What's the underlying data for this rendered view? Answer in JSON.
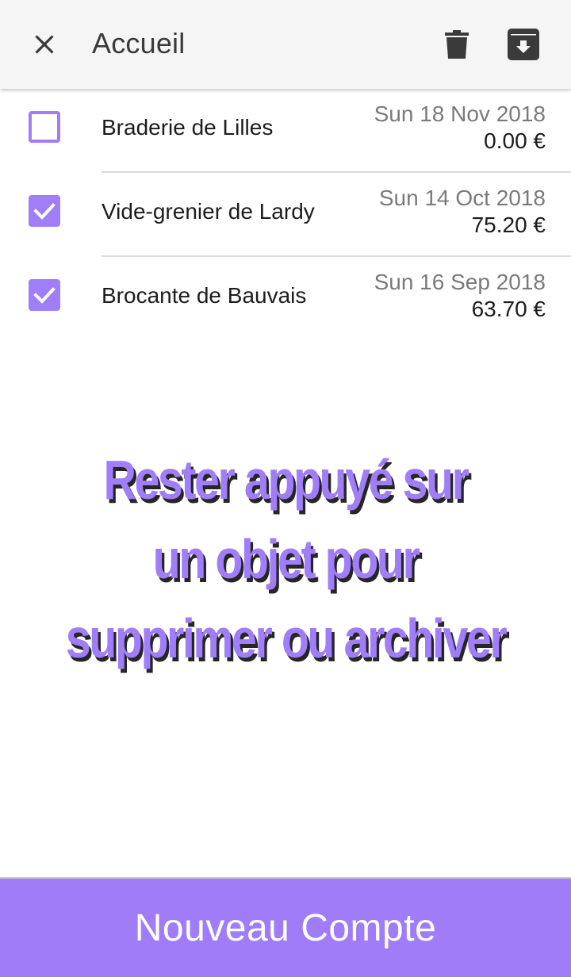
{
  "appbar": {
    "title": "Accueil",
    "icons": {
      "close": "close-icon",
      "delete": "trash-icon",
      "archive": "archive-icon"
    }
  },
  "items": [
    {
      "name": "Braderie de Lilles",
      "date": "Sun 18 Nov 2018",
      "amount": "0.00 €",
      "checked": false
    },
    {
      "name": "Vide-grenier de Lardy",
      "date": "Sun 14 Oct 2018",
      "amount": "75.20 €",
      "checked": true
    },
    {
      "name": "Brocante de Bauvais",
      "date": "Sun 16 Sep 2018",
      "amount": "63.70 €",
      "checked": true
    }
  ],
  "hint": {
    "lines": [
      "Rester appuyé sur",
      "un objet pour",
      "supprimer ou archiver"
    ]
  },
  "new_button": {
    "label": "Nouveau Compte"
  },
  "colors": {
    "accent": "#9f7ef8",
    "appbar_bg": "#f5f5f5",
    "title_text": "#3a3a3a",
    "date_text": "#7a7a7a",
    "hint_shadow": "#262626"
  }
}
